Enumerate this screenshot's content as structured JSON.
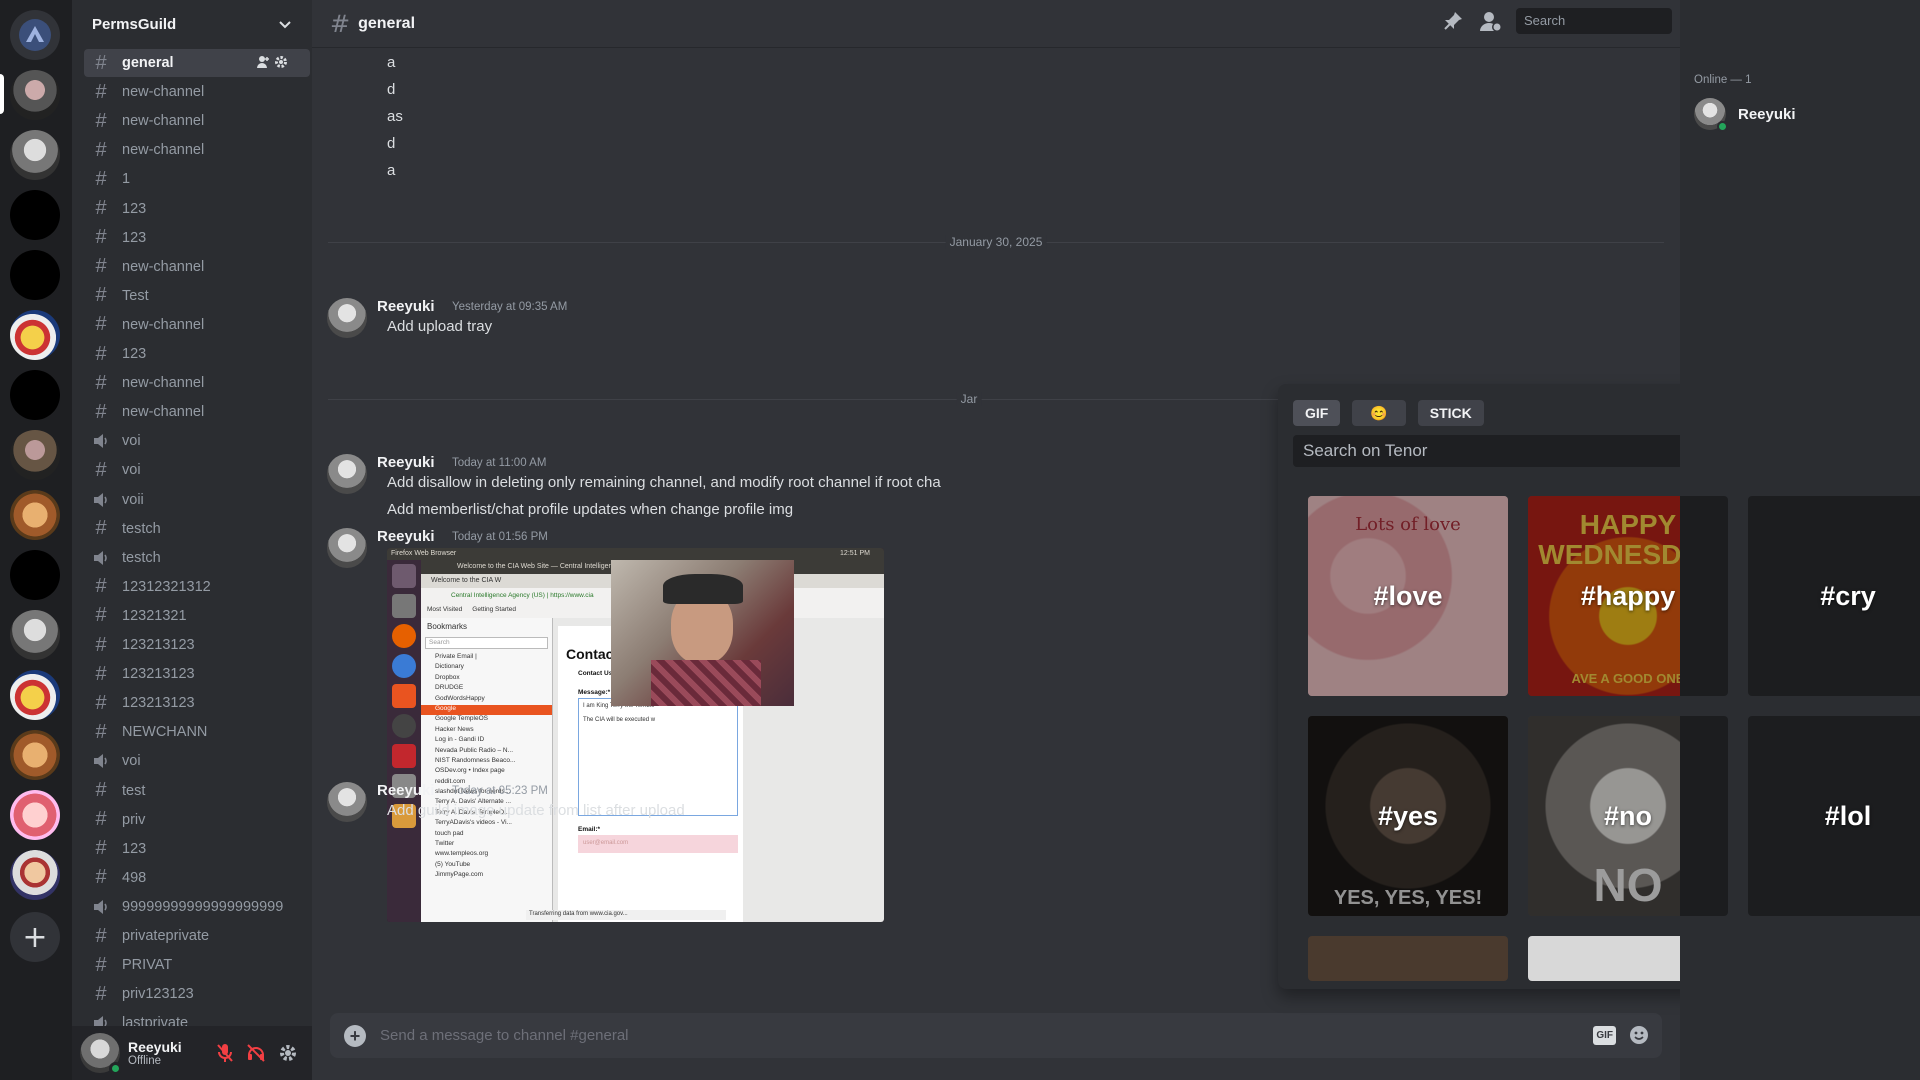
{
  "guild": {
    "name": "PermsGuild"
  },
  "channel": {
    "name": "general"
  },
  "channels": [
    {
      "name": "general",
      "type": "text",
      "active": true
    },
    {
      "name": "new-channel",
      "type": "text"
    },
    {
      "name": "new-channel",
      "type": "text"
    },
    {
      "name": "new-channel",
      "type": "text"
    },
    {
      "name": "1",
      "type": "text"
    },
    {
      "name": "123",
      "type": "text"
    },
    {
      "name": "123",
      "type": "text"
    },
    {
      "name": "new-channel",
      "type": "text"
    },
    {
      "name": "Test",
      "type": "text"
    },
    {
      "name": "new-channel",
      "type": "text"
    },
    {
      "name": "123",
      "type": "text"
    },
    {
      "name": "new-channel",
      "type": "text"
    },
    {
      "name": "new-channel",
      "type": "text"
    },
    {
      "name": "voi",
      "type": "voice"
    },
    {
      "name": "voi",
      "type": "text"
    },
    {
      "name": "voii",
      "type": "voice"
    },
    {
      "name": "testch",
      "type": "text"
    },
    {
      "name": "testch",
      "type": "voice"
    },
    {
      "name": "12312321312",
      "type": "text"
    },
    {
      "name": "12321321",
      "type": "text"
    },
    {
      "name": "123213123",
      "type": "text"
    },
    {
      "name": "123213123",
      "type": "text"
    },
    {
      "name": "123213123",
      "type": "text"
    },
    {
      "name": "NEWCHANN",
      "type": "text"
    },
    {
      "name": "voi",
      "type": "voice"
    },
    {
      "name": "test",
      "type": "text"
    },
    {
      "name": "priv",
      "type": "text"
    },
    {
      "name": "123",
      "type": "text"
    },
    {
      "name": "498",
      "type": "text"
    },
    {
      "name": "99999999999999999999",
      "type": "voice"
    },
    {
      "name": "privateprivate",
      "type": "text"
    },
    {
      "name": "PRIVAT",
      "type": "text"
    },
    {
      "name": "priv123123",
      "type": "text"
    },
    {
      "name": "lastprivate",
      "type": "voice"
    }
  ],
  "user_panel": {
    "name": "Reeyuki",
    "status": "Offline"
  },
  "top": {
    "search_placeholder": "Search"
  },
  "messages": {
    "short_lines": [
      "a",
      "d",
      "as",
      "d",
      "a"
    ],
    "date_divider_1": "January 30, 2025",
    "date_divider_2": "Jar",
    "m1": {
      "author": "Reeyuki",
      "time": "Yesterday at 09:35 AM",
      "text": "Add upload tray"
    },
    "m2": {
      "author": "Reeyuki",
      "time": "Today at 11:00 AM",
      "lines": [
        "Add disallow in deleting only remaining channel, and modify root channel if root cha",
        "Add memberlist/chat profile updates when change profile img"
      ]
    },
    "m3": {
      "author": "Reeyuki",
      "time": "Today at 01:56 PM"
    },
    "m4": {
      "author": "Reeyuki",
      "time": "Today at 05:23 PM",
      "text": "Add guild image update from list after upload"
    }
  },
  "screenshot": {
    "topbar_title": "Firefox Web Browser",
    "topbar_time": "12:51 PM",
    "window_title": "Welcome to the CIA Web Site — Central Intelligence",
    "tab": "Welcome to the CIA W",
    "url": "Central Intelligence Agency (US) | https://www.cia",
    "bookmarks_bar": [
      "Most Visited",
      "Getting Started"
    ],
    "bookmarks_title": "Bookmarks",
    "bookmarks_search": "Search",
    "bookmarks": [
      "Private Email |",
      "Dictionary",
      "Dropbox",
      "DRUDGE",
      "GodWordsHappy",
      "Google",
      "Google TempleOS",
      "Hacker News",
      "Log in - Gandi ID",
      "Nevada Public Radio – N...",
      "NIST Randomness Beaco...",
      "OSDev.org • Index page",
      "reddit.com",
      "slashdot News for nerds...",
      "Terry A. Davis' Alternate ...",
      "Terry A. Davis' TempleO...",
      "TerryADavis's videos - Vi...",
      "touch pad",
      "Twitter",
      "www.templeos.org",
      "(5) YouTube",
      "JimmyPage.com"
    ],
    "page_heading": "Contact CIA",
    "form_title": "Contact Us Form",
    "message_label": "Message:*",
    "message_line1": "I am King Terry the Terrible",
    "message_line2": "The CIA will be executed w",
    "email_label": "Email:*",
    "email_placeholder": "user@email.com",
    "status": "Transferring data from www.cia.gov..."
  },
  "composer": {
    "placeholder": "Send a message to channel #general",
    "gif": "GIF"
  },
  "members": {
    "header": "Online — 1",
    "list": [
      {
        "name": "Reeyuki",
        "status": "online"
      }
    ]
  },
  "gif_picker": {
    "tabs": [
      "GIF",
      "😊",
      "STICK"
    ],
    "search_placeholder": "Search on Tenor",
    "tiles": [
      {
        "tag": "#love",
        "caption": "Lots of love"
      },
      {
        "tag": "#happy",
        "caption": "HAPPY WEDNESDAY",
        "caption2": "AVE A GOOD ONE"
      },
      {
        "tag": "#cry"
      },
      {
        "tag": "#yes",
        "caption": "YES, YES, YES!"
      },
      {
        "tag": "#no",
        "caption": "NO"
      },
      {
        "tag": "#lol"
      }
    ]
  },
  "colors": {
    "accent": "#5865f2",
    "online": "#23a55a",
    "danger": "#f23f43"
  }
}
